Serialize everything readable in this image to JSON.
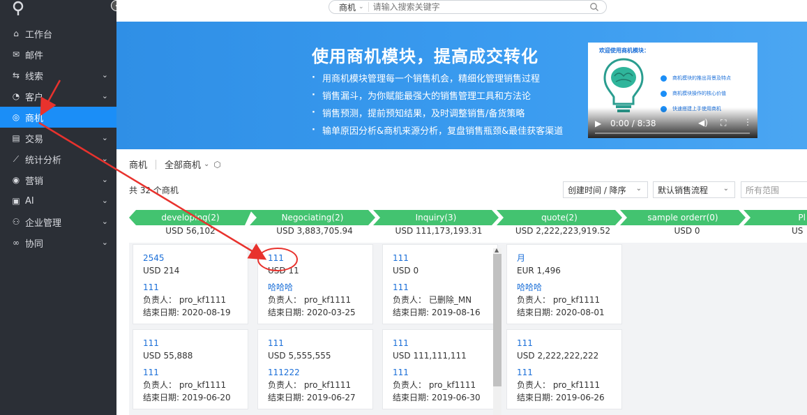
{
  "sidebar": {
    "items": [
      {
        "label": "工作台",
        "icon": "home-icon",
        "has_arrow": false
      },
      {
        "label": "邮件",
        "icon": "mail-icon",
        "has_arrow": false
      },
      {
        "label": "线索",
        "icon": "leads-icon",
        "has_arrow": true
      },
      {
        "label": "客户",
        "icon": "customer-icon",
        "has_arrow": true
      },
      {
        "label": "商机",
        "icon": "opportunity-icon",
        "has_arrow": false,
        "active": true
      },
      {
        "label": "交易",
        "icon": "deal-icon",
        "has_arrow": true
      },
      {
        "label": "统计分析",
        "icon": "chart-icon",
        "has_arrow": true
      },
      {
        "label": "营销",
        "icon": "marketing-icon",
        "has_arrow": true
      },
      {
        "label": "AI",
        "icon": "ai-icon",
        "has_arrow": true
      },
      {
        "label": "企业管理",
        "icon": "org-icon",
        "has_arrow": true
      },
      {
        "label": "协同",
        "icon": "collab-icon",
        "has_arrow": true
      }
    ]
  },
  "search": {
    "scope": "商机",
    "placeholder": "请输入搜索关键字"
  },
  "banner": {
    "title": "使用商机模块，提高成交转化",
    "points": [
      "用商机模块管理每一个销售机会，精细化管理销售过程",
      "销售漏斗，为你赋能最强大的销售管理工具和方法论",
      "销售预测，提前预知结果，及时调整销售/备货策略",
      "输单原因分析&商机来源分析，复盘销售瓶颈&最佳获客渠道"
    ],
    "video": {
      "heading": "欢迎使用商机模块：",
      "points": [
        "商机模块的推出背景及特点",
        "商机模块操作的核心价值",
        "快速搭建上手使用商机"
      ],
      "time": "0:00 / 8:38"
    }
  },
  "content": {
    "title": "商机",
    "filter": "全部商机",
    "count": "共 32 个商机",
    "sort": "创建时间 / 降序",
    "flow": "默认销售流程",
    "range_placeholder": "所有范围"
  },
  "stages": [
    {
      "name": "developing(2)",
      "amount": "USD 56,102"
    },
    {
      "name": "Negociating(2)",
      "amount": "USD 3,883,705.94"
    },
    {
      "name": "Inquiry(3)",
      "amount": "USD 111,173,193.31"
    },
    {
      "name": "quote(2)",
      "amount": "USD 2,222,223,919.52"
    },
    {
      "name": "sample orderr(0)",
      "amount": "USD 0"
    },
    {
      "name": "Pl",
      "amount": "US"
    }
  ],
  "cards": [
    {
      "title": "2545",
      "amount": "USD 214",
      "customer": "111",
      "owner": "负责人： pro_kf1111",
      "end": "结束日期: 2020-08-19"
    },
    {
      "title": "111",
      "amount": "USD 11",
      "customer": "哈哈哈",
      "owner": "负责人： pro_kf1111",
      "end": "结束日期: 2020-03-25"
    },
    {
      "title": "111",
      "amount": "USD 0",
      "customer": "111",
      "owner": "负责人： 已删除_MN",
      "end": "结束日期: 2019-08-16"
    },
    {
      "title": "月",
      "amount": "EUR 1,496",
      "customer": "哈哈哈",
      "owner": "负责人： pro_kf1111",
      "end": "结束日期: 2020-08-01"
    },
    {
      "title": "111",
      "amount": "USD 55,888",
      "customer": "111",
      "owner": "负责人： pro_kf1111",
      "end": "结束日期: 2019-06-20"
    },
    {
      "title": "111",
      "amount": "USD 5,555,555",
      "customer": "111222",
      "owner": "负责人： pro_kf1111",
      "end": "结束日期: 2019-06-27"
    },
    {
      "title": "111",
      "amount": "USD 111,111,111",
      "customer": "111",
      "owner": "负责人： pro_kf1111",
      "end": "结束日期: 2019-06-30"
    },
    {
      "title": "111",
      "amount": "USD 2,222,222,222",
      "customer": "111",
      "owner": "负责人： pro_kf1111",
      "end": "结束日期: 2019-06-26"
    }
  ],
  "colors": {
    "sidebar_bg": "#2b2f36",
    "active": "#1b8ef7",
    "stage": "#43c370",
    "link": "#1b6fd8",
    "annotation": "#e8322d"
  }
}
